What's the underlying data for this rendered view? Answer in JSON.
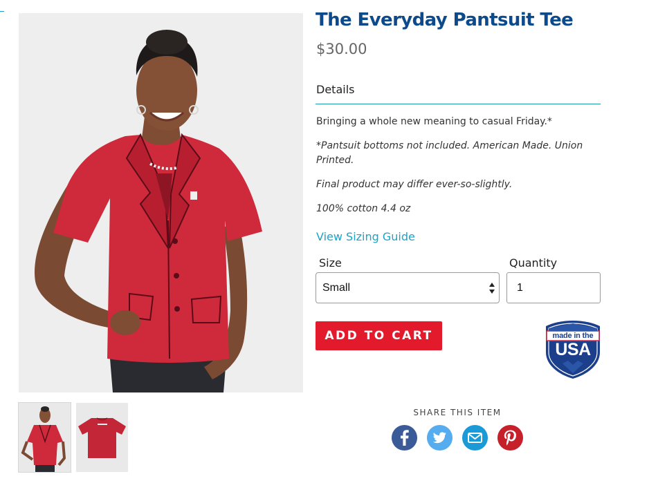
{
  "product": {
    "title": "The Everyday Pantsuit Tee",
    "price": "$30.00",
    "details_heading": "Details",
    "description": [
      "Bringing a whole new meaning to casual Friday.*",
      "*Pantsuit bottoms not included. American Made. Union Printed.",
      "Final product may differ ever-so-slightly.",
      "100% cotton 4.4 oz"
    ],
    "sizing_link": "View Sizing Guide"
  },
  "options": {
    "size_label": "Size",
    "size_value": "Small",
    "quantity_label": "Quantity",
    "quantity_value": "1"
  },
  "cart": {
    "add_label": "ADD TO CART"
  },
  "badge": {
    "line1": "made in the",
    "line2": "USA"
  },
  "share": {
    "label": "SHARE THIS ITEM",
    "networks": [
      "facebook",
      "twitter",
      "email",
      "pinterest"
    ]
  },
  "gallery": {
    "thumbnails": [
      "model-front",
      "shirt-back"
    ]
  },
  "colors": {
    "title": "#0c4a8c",
    "accent_link": "#1aa4c8",
    "button": "#e21a2c",
    "shirt": "#cf2a3b",
    "facebook": "#3b5a98",
    "twitter": "#55acee",
    "email": "#1a9bd7",
    "pinterest": "#c6202b"
  }
}
